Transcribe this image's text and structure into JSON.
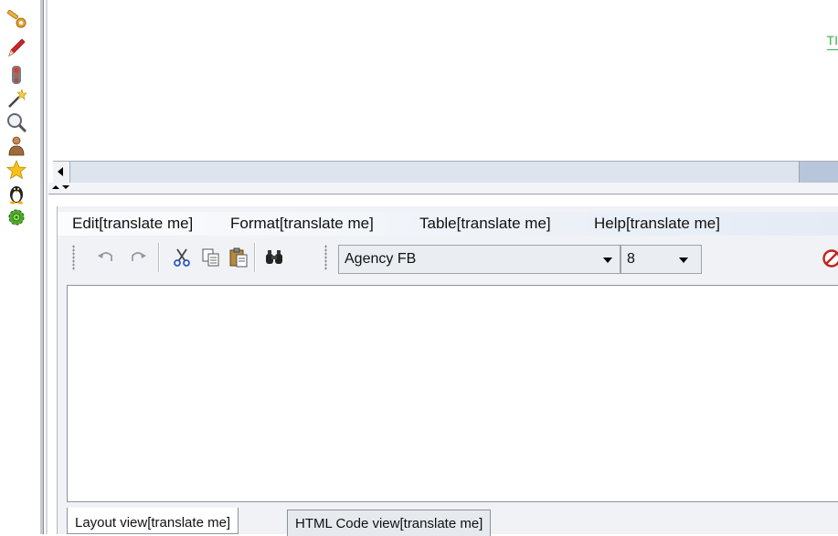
{
  "left_toolbar": {
    "icons": [
      "key-icon",
      "pencil-icon",
      "traffic-light-icon",
      "magic-wand-icon",
      "magnifier-icon",
      "user-icon",
      "star-icon",
      "tux-icon",
      "settings-gear-icon"
    ]
  },
  "top_panel": {
    "label": "TI"
  },
  "editor": {
    "menu": {
      "edit": "Edit[translate me]",
      "format": "Format[translate me]",
      "table": "Table[translate me]",
      "help": "Help[translate me]"
    },
    "toolbar": {
      "icons": [
        "undo-icon",
        "redo-icon",
        "cut-icon",
        "copy-icon",
        "paste-icon",
        "find-icon",
        "stop-icon"
      ],
      "font_family": "Agency FB",
      "font_size": "8"
    },
    "tabs": {
      "layout": "Layout view[translate me]",
      "html": "HTML Code view[translate me]"
    }
  },
  "colors": {
    "ti_label": "#37b24a",
    "scroll_track": "#b7c6da",
    "panel_bg": "#f0f2f5"
  }
}
